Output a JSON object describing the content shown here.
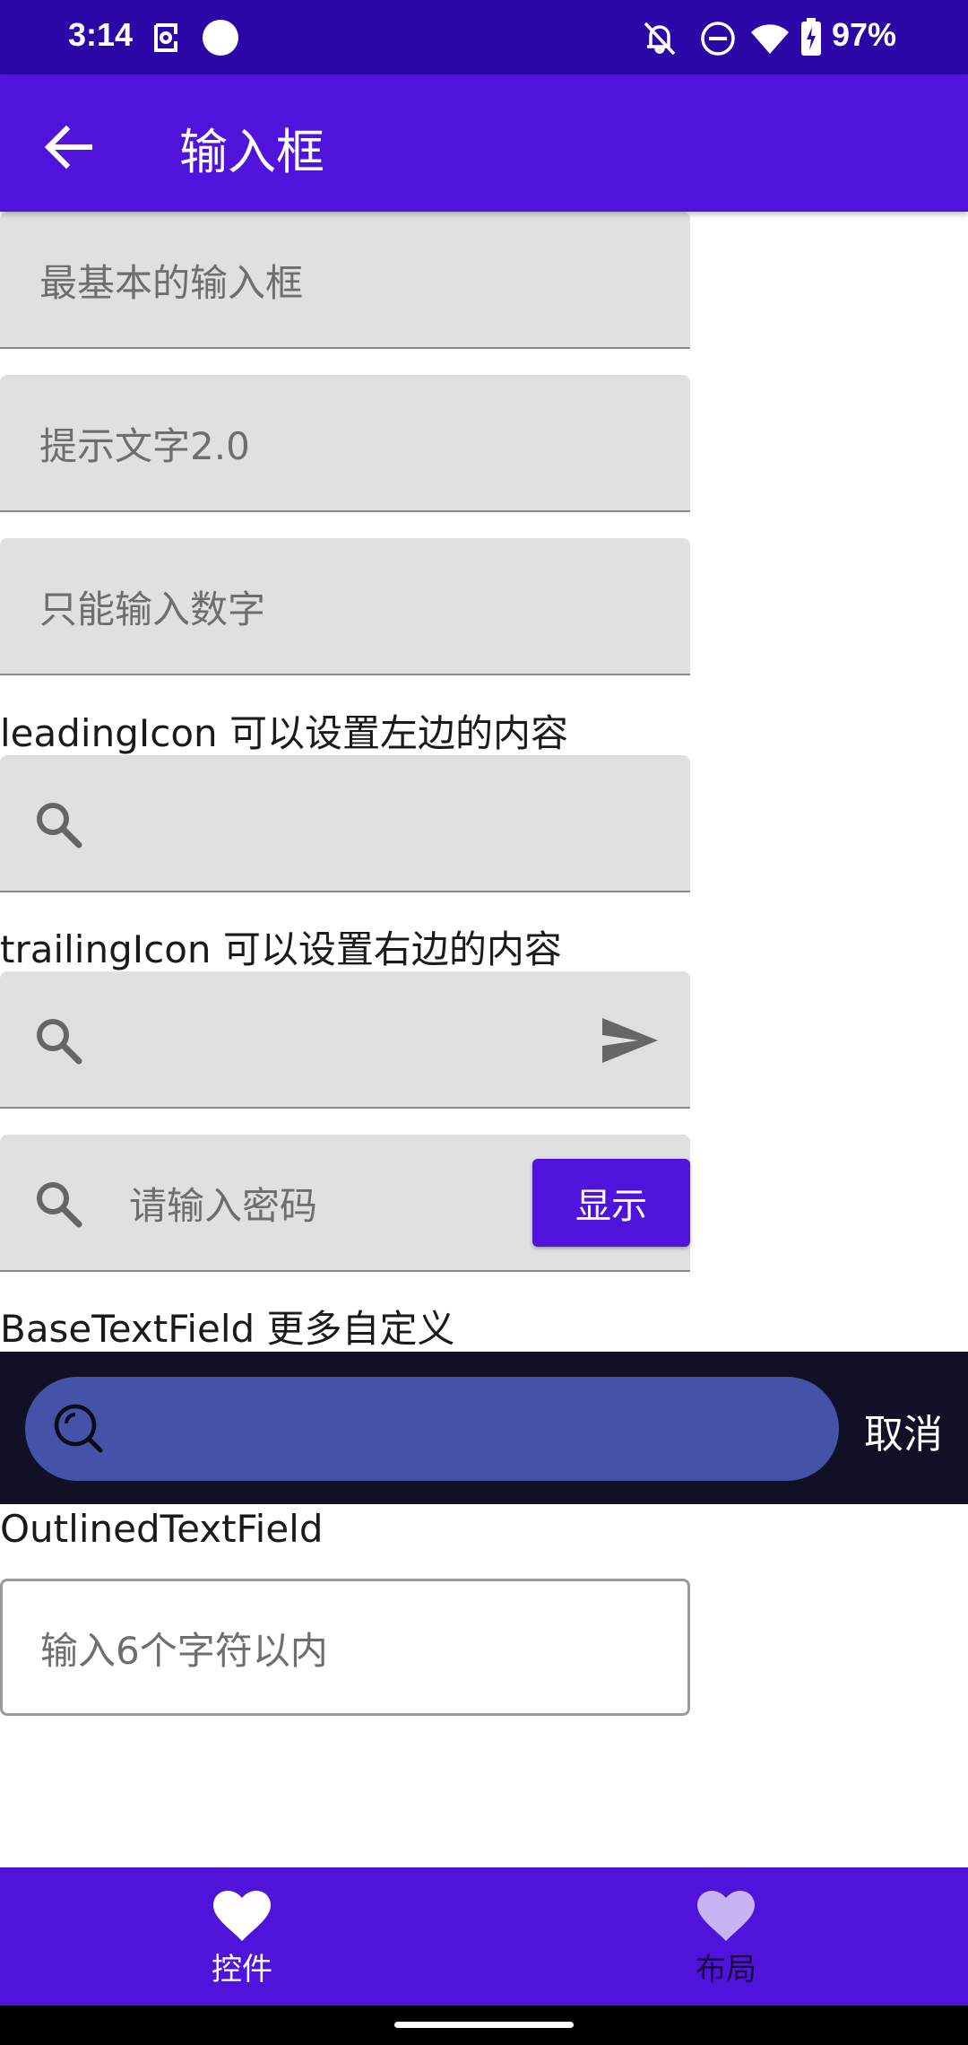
{
  "status_bar": {
    "time": "3:14",
    "battery": "97%",
    "icons": [
      "notification-app-icon",
      "dot-icon",
      "bell-off-icon",
      "do-not-disturb-icon",
      "wifi-icon",
      "battery-icon"
    ]
  },
  "app_bar": {
    "title": "输入框",
    "back_icon": "arrow-back-icon"
  },
  "fields": {
    "basic_placeholder": "最基本的输入框",
    "hint_placeholder": "提示文字2.0",
    "number_placeholder": "只能输入数字",
    "leading_label": "leadingIcon 可以设置左边的内容",
    "trailing_label": "trailingIcon 可以设置右边的内容",
    "password_placeholder": "请输入密码",
    "show_button": "显示",
    "base_label": "BaseTextField 更多自定义",
    "cancel": "取消",
    "outlined_label": "OutlinedTextField",
    "outlined_placeholder": "输入6个字符以内"
  },
  "bottom_nav": {
    "items": [
      {
        "label": "控件",
        "icon": "heart-icon",
        "selected": true
      },
      {
        "label": "布局",
        "icon": "heart-icon",
        "selected": false
      }
    ]
  },
  "colors": {
    "status_bar": "#2a07a6",
    "primary": "#5013db",
    "field_bg": "#e0e0e0",
    "dark_strip": "#101126",
    "pill": "#4452a7"
  }
}
